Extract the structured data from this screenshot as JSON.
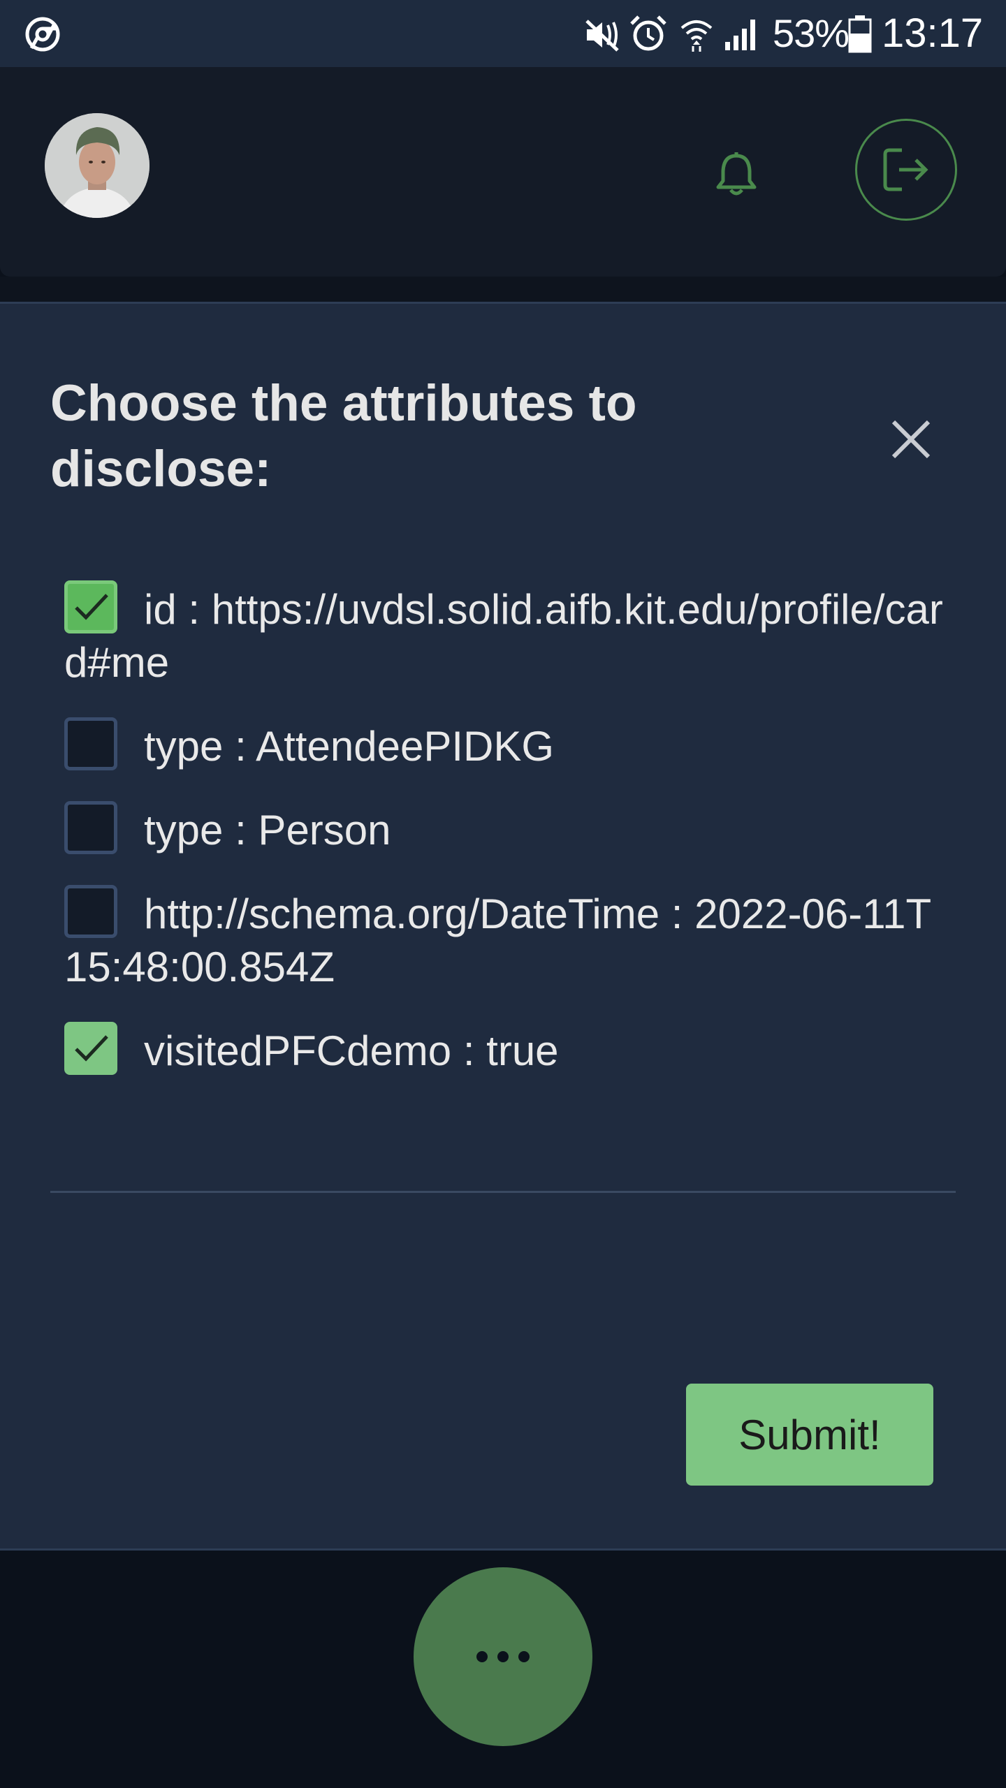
{
  "status_bar": {
    "battery_percent": "53%",
    "time": "13:17",
    "icons": [
      "chrome-icon",
      "mute-icon",
      "alarm-icon",
      "wifi-icon",
      "signal-icon",
      "battery-icon"
    ]
  },
  "header": {
    "avatar": "user-avatar",
    "notification_icon": "bell-icon",
    "logout_icon": "logout-icon",
    "accent_color": "#4a8a4c"
  },
  "modal": {
    "title": "Choose the attributes to disclose:",
    "close_icon": "close-icon",
    "attributes": [
      {
        "label": "id : https://uvdsl.solid.aifb.kit.edu/profile/card#me",
        "checked": true
      },
      {
        "label": "type : AttendeePIDKG",
        "checked": false
      },
      {
        "label": "type : Person",
        "checked": false
      },
      {
        "label": "http://schema.org/DateTime : 2022-06-11T15:48:00.854Z",
        "checked": false
      },
      {
        "label": "visitedPFCdemo : true",
        "checked": true
      }
    ],
    "submit_label": "Submit!",
    "submit_color": "#7ec683"
  },
  "bottom_bar": {
    "fab_icon": "more-dots-icon",
    "fab_color": "#4a7a4d"
  }
}
